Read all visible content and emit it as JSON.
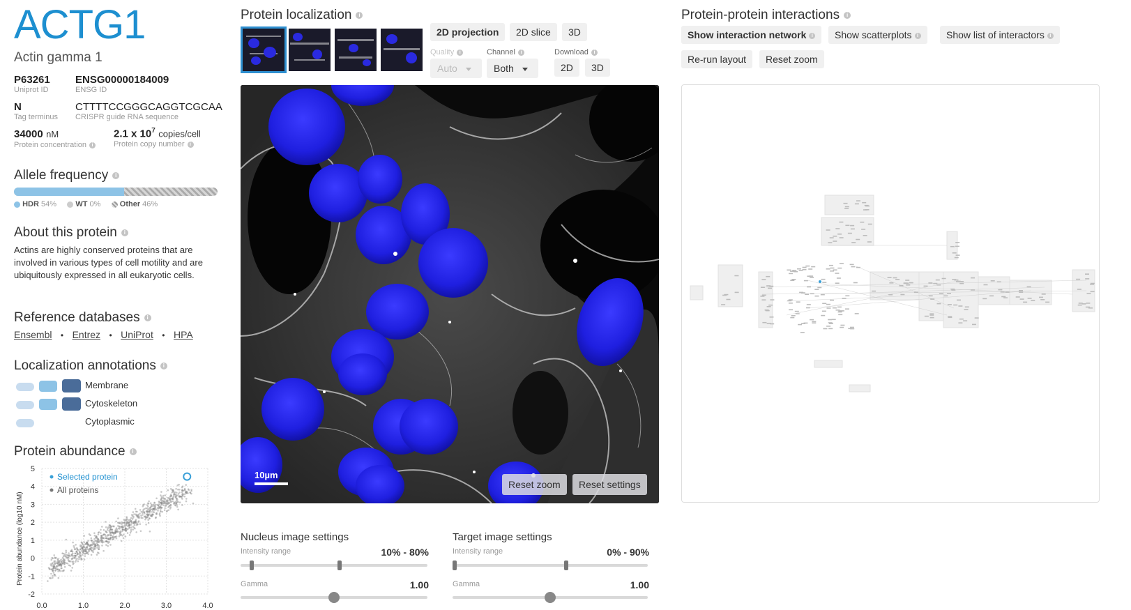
{
  "gene": {
    "symbol": "ACTG1",
    "name": "Actin gamma 1"
  },
  "ids": {
    "uniprot": {
      "value": "P63261",
      "label": "Uniprot ID"
    },
    "ensg": {
      "value": "ENSG00000184009",
      "label": "ENSG ID"
    },
    "tag": {
      "value": "N",
      "label": "Tag terminus"
    },
    "guide": {
      "value": "CTTTTCCGGGCAGGTCGCAA",
      "label": "CRISPR guide RNA sequence"
    },
    "concentration": {
      "value": "34000",
      "unit": "nM",
      "label": "Protein concentration"
    },
    "copies": {
      "base": "2.1 x 10",
      "exp": "7",
      "unit": "copies/cell",
      "label": "Protein copy number"
    }
  },
  "allele": {
    "title": "Allele frequency",
    "hdr_fraction": 0.54,
    "legend": [
      {
        "name": "HDR",
        "pct": "54%"
      },
      {
        "name": "WT",
        "pct": "0%"
      },
      {
        "name": "Other",
        "pct": "46%"
      }
    ]
  },
  "about": {
    "title": "About this protein",
    "text": "Actins are highly conserved proteins that are involved in various types of cell motility and are ubiquitously expressed in all eukaryotic cells."
  },
  "refs": {
    "title": "Reference databases",
    "links": [
      "Ensembl",
      "Entrez",
      "UniProt",
      "HPA"
    ],
    "separator": "•"
  },
  "localization_annotations": {
    "title": "Localization annotations",
    "items": [
      {
        "label": "Membrane",
        "level": 3
      },
      {
        "label": "Cytoskeleton",
        "level": 3
      },
      {
        "label": "Cytoplasmic",
        "level": 1
      }
    ]
  },
  "abundance": {
    "title": "Protein abundance",
    "legend_selected": "Selected protein",
    "legend_all": "All proteins"
  },
  "chart_data": {
    "type": "scatter",
    "ylabel": "Protein abundance (log10 nM)",
    "xlabel": "",
    "xlim": [
      0,
      4
    ],
    "ylim": [
      -2,
      5
    ],
    "x_ticks": [
      "0.0",
      "1.0",
      "2.0",
      "3.0",
      "4.0"
    ],
    "y_ticks": [
      "5",
      "4",
      "3",
      "2",
      "1",
      "0",
      "-1",
      "-2"
    ],
    "series": [
      {
        "name": "Selected protein",
        "points": [
          [
            3.5,
            4.55
          ]
        ]
      },
      {
        "name": "All proteins",
        "description_points": "dense cloud, roughly from (0.2,-0.5) to (3.5,4.2)"
      }
    ],
    "colors": {
      "selected": "#5aa9d6",
      "all": "#888888"
    }
  },
  "localization": {
    "title": "Protein localization",
    "view_buttons": [
      "2D projection",
      "2D slice",
      "3D"
    ],
    "active_view": "2D projection",
    "quality": {
      "label": "Quality",
      "value": "Auto"
    },
    "channel": {
      "label": "Channel",
      "value": "Both"
    },
    "download": {
      "label": "Download",
      "buttons": [
        "2D",
        "3D"
      ]
    },
    "scale_bar": "10µm",
    "reset_zoom": "Reset zoom",
    "reset_settings": "Reset settings"
  },
  "nucleus_settings": {
    "title": "Nucleus image settings",
    "range_label": "Intensity range",
    "range_value": "10% - 80%",
    "range_min": 0.05,
    "range_max": 0.55,
    "gamma_label": "Gamma",
    "gamma_value": "1.00",
    "gamma_pos": 0.5
  },
  "target_settings": {
    "title": "Target image settings",
    "range_label": "Intensity range",
    "range_value": "0% - 90%",
    "range_min": 0.0,
    "range_max": 0.6,
    "gamma_label": "Gamma",
    "gamma_value": "1.00",
    "gamma_pos": 0.5
  },
  "ppi": {
    "title": "Protein-protein interactions",
    "buttons": [
      "Show interaction network",
      "Show scatterplots",
      "Show list of interactors"
    ],
    "active": "Show interaction network",
    "rerun": "Re-run layout",
    "reset_zoom": "Reset zoom"
  },
  "colors": {
    "brand": "#1d8fd0",
    "hdr": "#8dc3e6",
    "membrane_dark": "#4a6c99",
    "selected": "#3aa0d8"
  }
}
